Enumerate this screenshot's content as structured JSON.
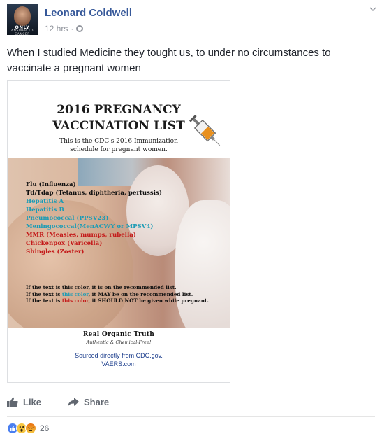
{
  "post": {
    "author": "Leonard Coldwell",
    "timestamp": "12 hrs",
    "privacy_icon": "globe-icon",
    "avatar_text": [
      "ONLY",
      "ANSWER TO CANCER"
    ],
    "text": "When I studied Medicine they tought us, to under no circumstances to vaccinate a pregnant women"
  },
  "image": {
    "title_lines": [
      "2016 PREGNANCY",
      "VACCINATION LIST"
    ],
    "subtitle_lines": [
      "This is the CDC's 2016 Immunization",
      "schedule for pregnant women."
    ],
    "vaccines": [
      {
        "text": "Flu (Influenza)",
        "status": "recommended"
      },
      {
        "text": "Td/Tdap (Tetanus, diphtheria, pertussis)",
        "status": "recommended"
      },
      {
        "text": "Hepatitis A",
        "status": "may"
      },
      {
        "text": "Hepatitis B",
        "status": "may"
      },
      {
        "text": "Pneumococcal (PPSV23)",
        "status": "may"
      },
      {
        "text": "Meningococcal(MenACWY or MPSV4)",
        "status": "may"
      },
      {
        "text": "MMR (Measles, mumps, rubella)",
        "status": "should_not"
      },
      {
        "text": "Chickenpox (Varicella)",
        "status": "should_not"
      },
      {
        "text": "Shingles (Zoster)",
        "status": "should_not"
      }
    ],
    "legend": [
      {
        "prefix": "If the text is this color, it is on the recommended list.",
        "colored": "",
        "suffix": ""
      },
      {
        "prefix": "If the text is ",
        "colored": "this color",
        "suffix": ", it MAY be on the recommended list."
      },
      {
        "prefix": "If the text is ",
        "colored": "this color",
        "suffix": ", it SHOULD NOT be given while pregnant."
      }
    ],
    "brand": "Real Organic Truth",
    "tagline": "Authentic & Chemical-Free!",
    "source_lines": [
      "Sourced directly from CDC.gov.",
      "VAERS.com"
    ]
  },
  "actions": {
    "like_label": "Like",
    "share_label": "Share"
  },
  "reactions": {
    "count": "26",
    "types": [
      "like",
      "wow",
      "angry"
    ]
  },
  "colors": {
    "author": "#365899",
    "recommended": "#111111",
    "may": "#1a9bb5",
    "should_not": "#c41a1a",
    "source": "#1a3c8c",
    "muted": "#90949c"
  }
}
